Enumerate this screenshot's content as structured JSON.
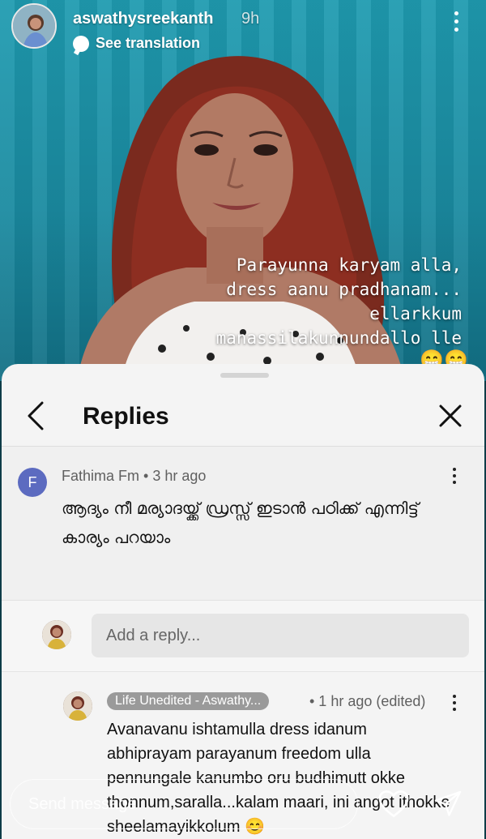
{
  "story": {
    "username": "aswathysreekanth",
    "time_ago": "9h",
    "translate_label": "See translation",
    "overlay_lines": [
      "Parayunna karyam alla,",
      "dress aanu pradhanam...",
      "ellarkkum",
      "manassilakunnundallo lle"
    ],
    "overlay_emoji": "😁😁"
  },
  "replies_sheet": {
    "title": "Replies",
    "comment": {
      "avatar_letter": "F",
      "avatar_color": "#5c6bc0",
      "author": "Fathima Fm",
      "time": "3 hr ago",
      "meta": "Fathima Fm • 3 hr ago",
      "text": "ആദ്യം നീ മര്യാദയ്ക്ക് ഡ്രസ്സ് ഇടാൻ പഠിക്ക് എന്നിട്ട് കാര്യം പറയാം",
      "reply_count": "1"
    },
    "reply_input": {
      "placeholder": "Add a reply..."
    },
    "reply": {
      "author_chip": "Life Unedited - Aswathy...",
      "meta": "• 1 hr ago (edited)",
      "text": "Avanavanu ishtamulla dress idanum abhiprayam parayanum freedom ulla pennungale kanumbo oru budhimutt okke thonnum,saralla...kalam maari, ini angot ithokke sheelamayikkolum 😊"
    }
  },
  "footer": {
    "send_placeholder": "Send message"
  }
}
